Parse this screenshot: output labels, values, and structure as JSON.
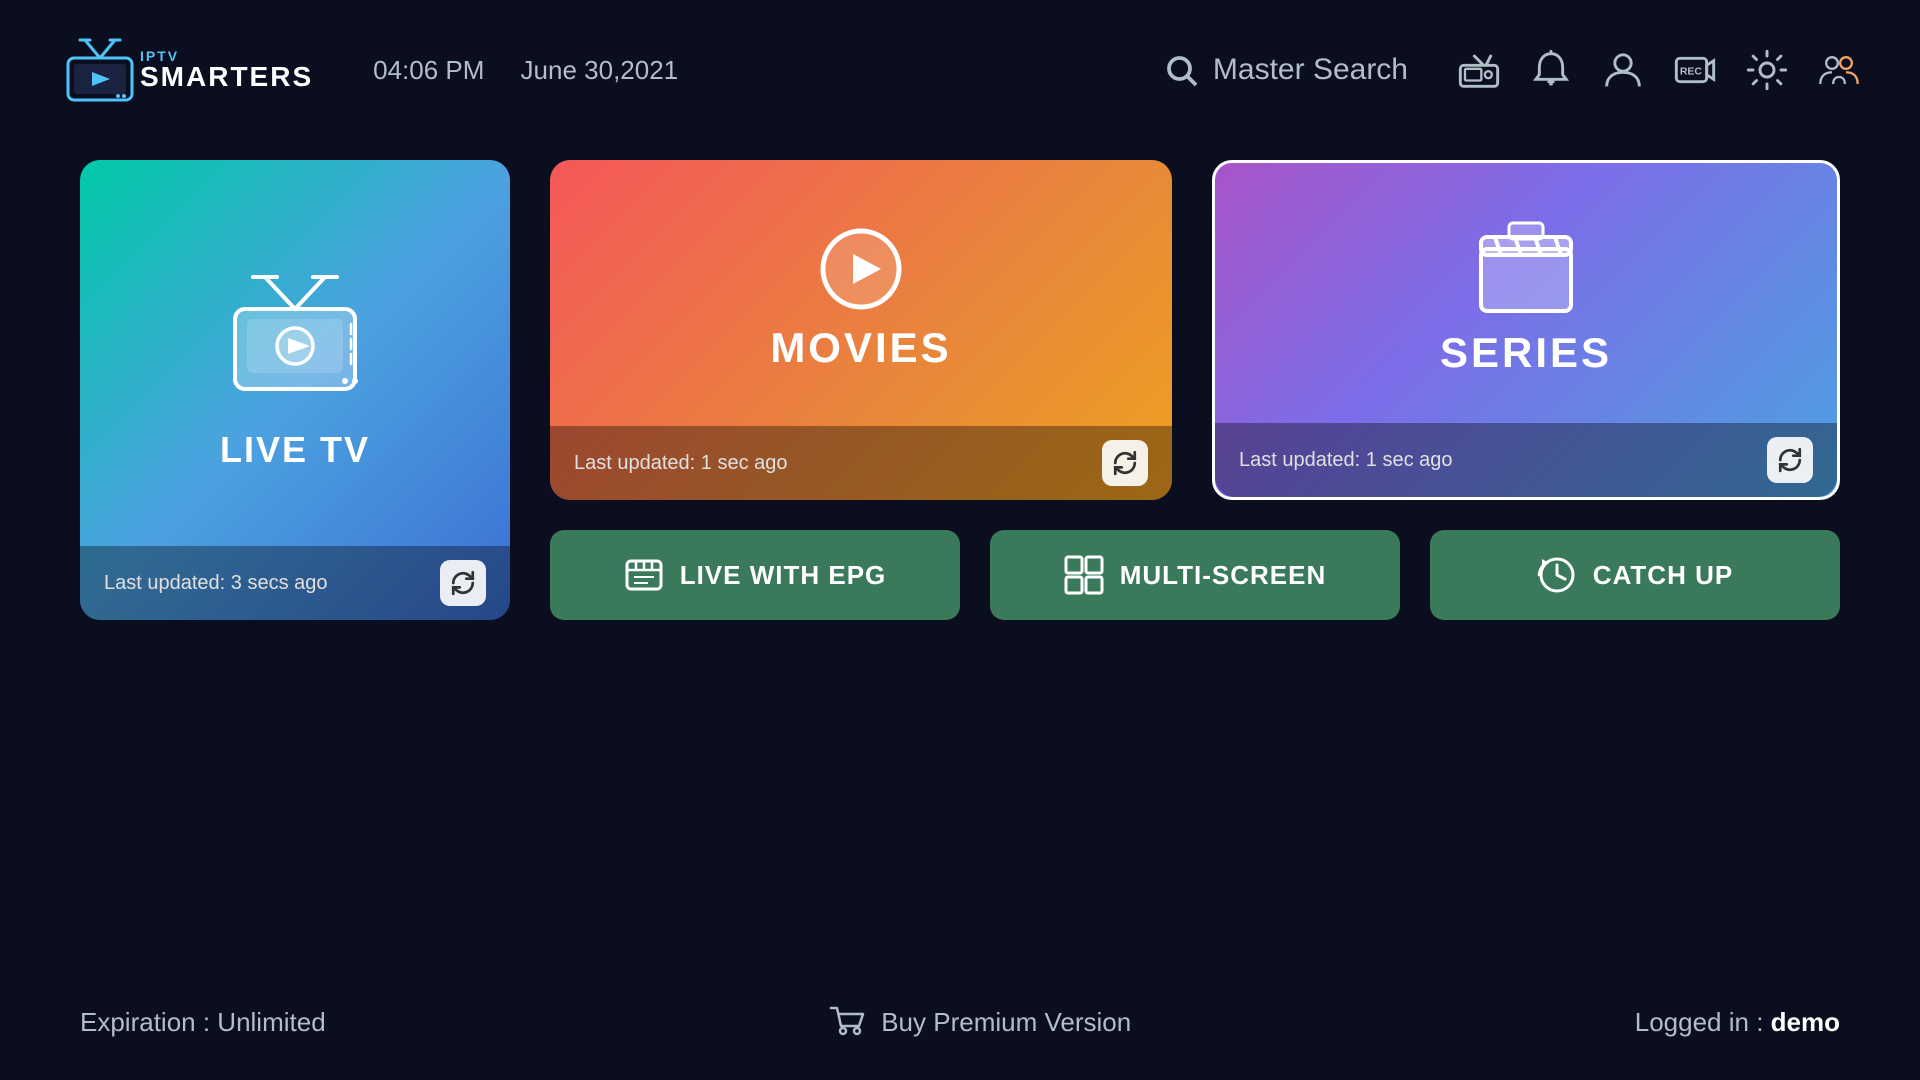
{
  "logo": {
    "text_iptv": "IPTV",
    "text_smarters": "SMARTERS"
  },
  "header": {
    "time": "04:06 PM",
    "date": "June 30,2021",
    "search_label": "Master Search"
  },
  "cards": {
    "live_tv": {
      "title": "LIVE TV",
      "last_updated": "Last updated: 3 secs ago"
    },
    "movies": {
      "title": "MOVIES",
      "last_updated": "Last updated: 1 sec ago"
    },
    "series": {
      "title": "SERIES",
      "last_updated": "Last updated: 1 sec ago"
    }
  },
  "action_buttons": {
    "live_epg": "LIVE WITH EPG",
    "multi_screen": "MULTI-SCREEN",
    "catch_up": "CATCH UP"
  },
  "footer": {
    "expiration_label": "Expiration : ",
    "expiration_value": "Unlimited",
    "buy_premium": "Buy Premium Version",
    "logged_in_label": "Logged in : ",
    "logged_in_user": "demo"
  }
}
